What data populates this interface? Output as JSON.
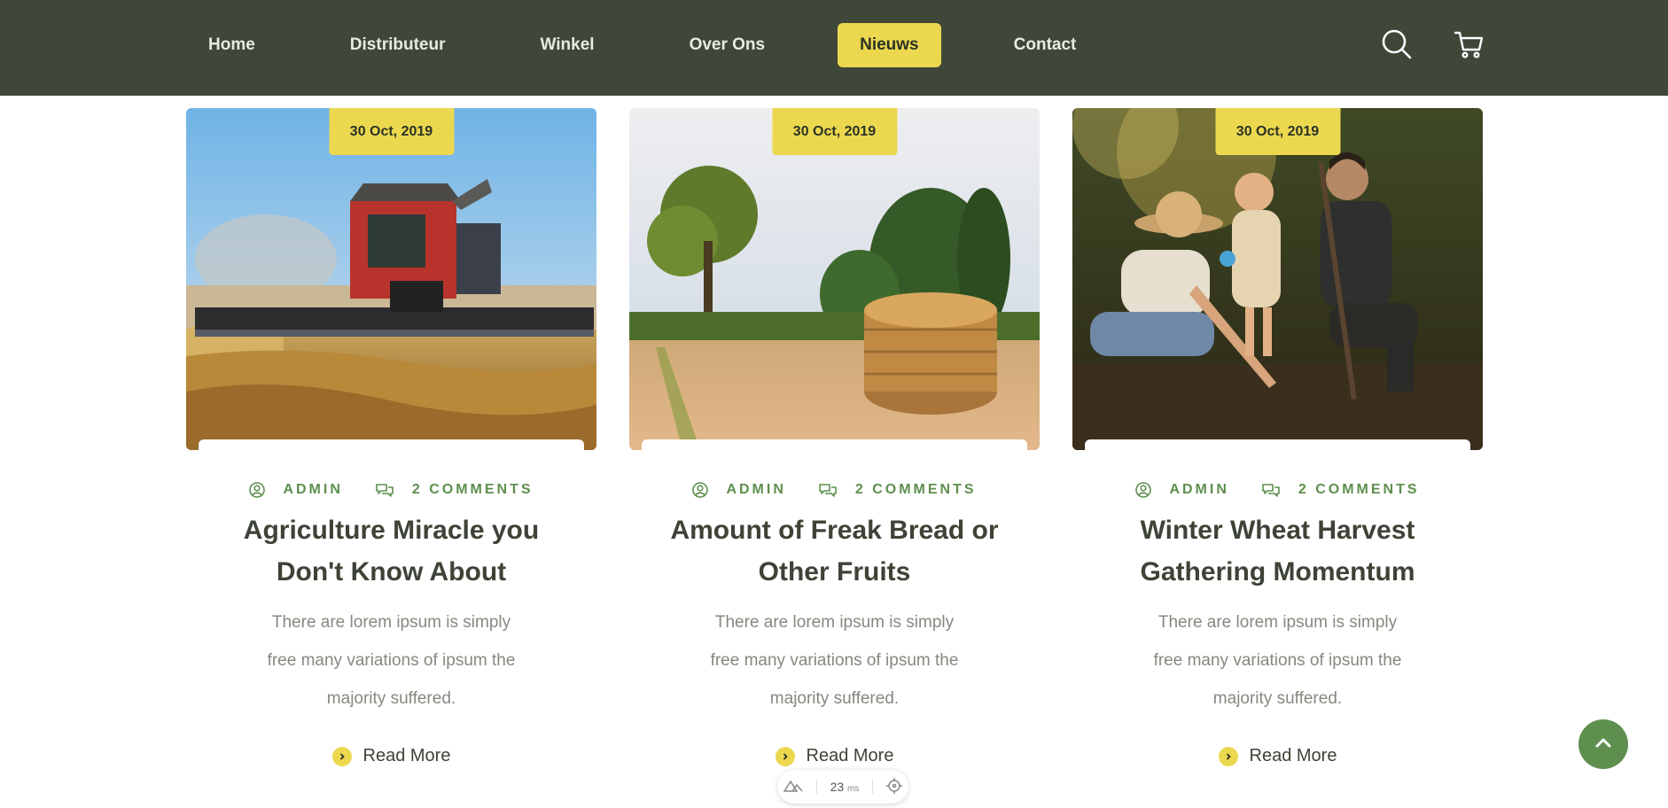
{
  "nav": {
    "items": [
      {
        "label": "Home"
      },
      {
        "label": "Distributeur"
      },
      {
        "label": "Winkel"
      },
      {
        "label": "Over Ons"
      },
      {
        "label": "Nieuws"
      },
      {
        "label": "Contact"
      }
    ],
    "active": "Nieuws",
    "icons": [
      "search-icon",
      "cart-icon"
    ]
  },
  "cards": [
    {
      "date": "30 Oct, 2019",
      "author": "ADMIN",
      "comments": "2 COMMENTS",
      "title": "Agriculture Miracle you Don't Know About",
      "text": "There are lorem ipsum is simply free many variations of ipsum the majority suffered.",
      "read_more": "Read More"
    },
    {
      "date": "30 Oct, 2019",
      "author": "ADMIN",
      "comments": "2 COMMENTS",
      "title": "Amount of Freak Bread or Other Fruits",
      "text": "There are lorem ipsum is simply free many variations of ipsum the majority suffered.",
      "read_more": "Read More"
    },
    {
      "date": "30 Oct, 2019",
      "author": "ADMIN",
      "comments": "2 COMMENTS",
      "title": "Winter Wheat Harvest Gathering Momentum",
      "text": "There are lorem ipsum is simply free many variations of ipsum the majority suffered.",
      "read_more": "Read More"
    }
  ],
  "perf_widget": {
    "value": "23",
    "unit": "ms"
  },
  "colors": {
    "header_bg": "#3f4739",
    "accent_yellow": "#ecd84f",
    "accent_green": "#5e8f4e",
    "heading": "#3d4336",
    "body_text": "#85897f"
  }
}
